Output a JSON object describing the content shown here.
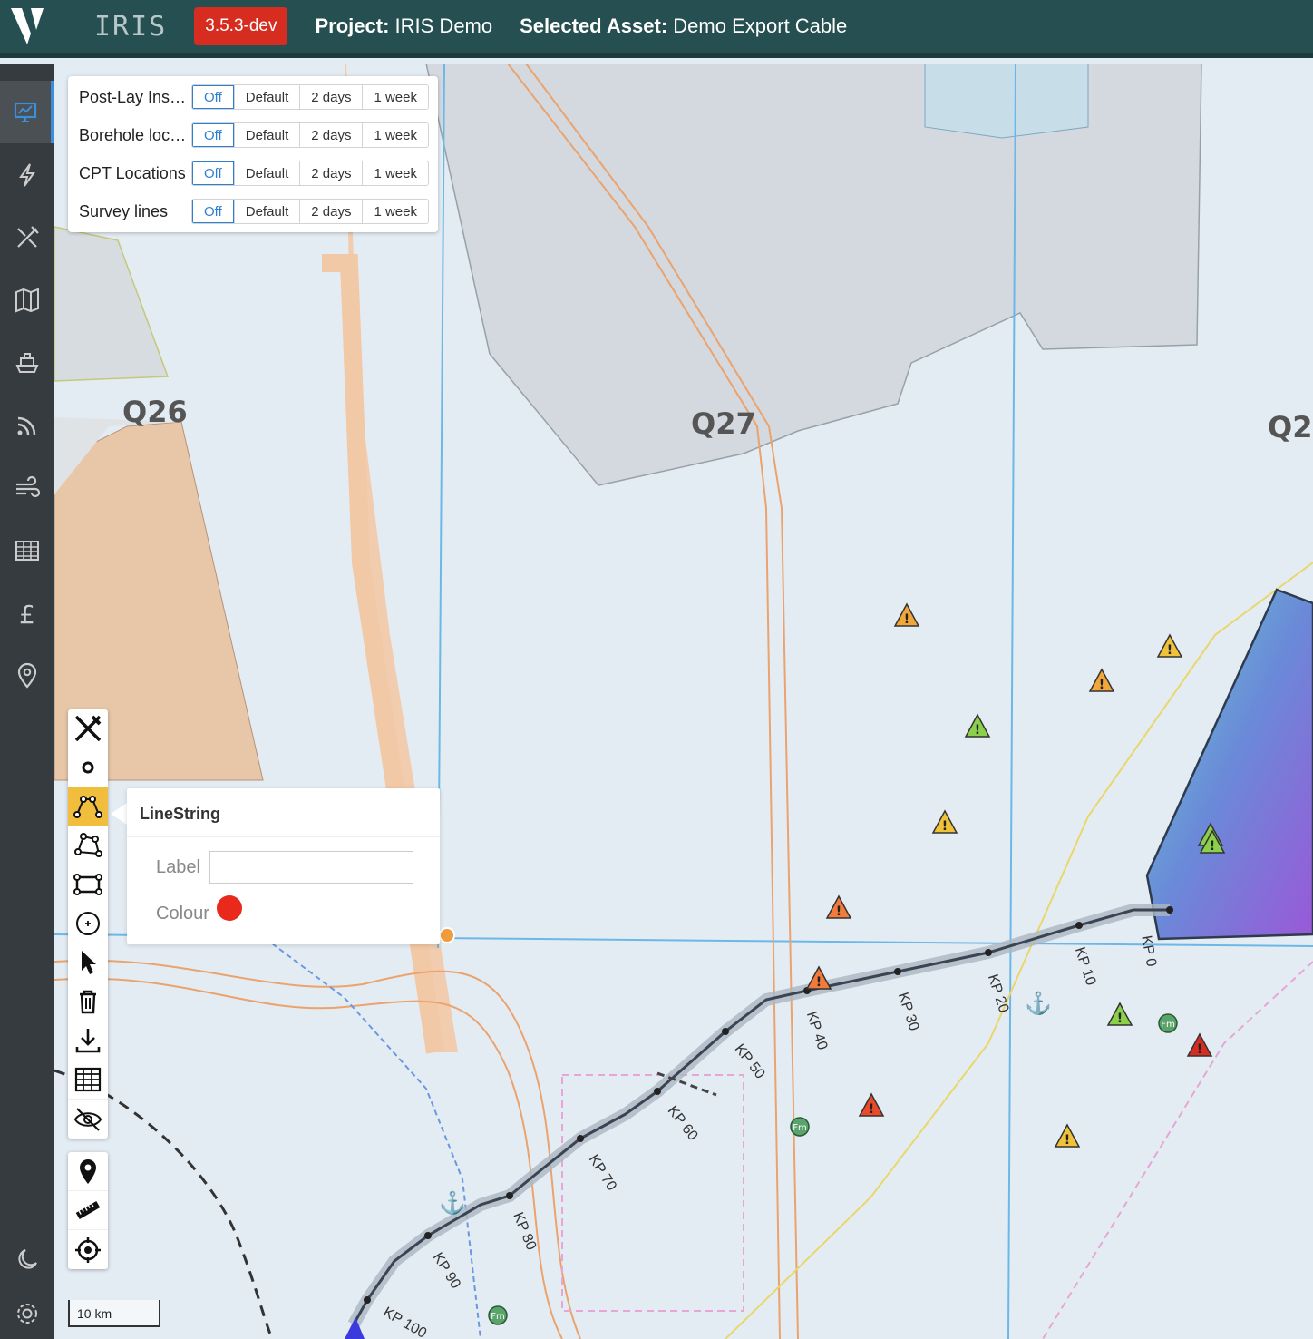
{
  "header": {
    "app_name": "IRIS",
    "version": "3.5.3-dev",
    "project_label": "Project:",
    "project_name": "IRIS Demo",
    "asset_label": "Selected Asset:",
    "asset_name": "Demo Export Cable"
  },
  "sidebar": {
    "items": [
      {
        "icon": "presentation-chart-icon",
        "active": true
      },
      {
        "icon": "lightning-icon",
        "active": false
      },
      {
        "icon": "tools-icon",
        "active": false
      },
      {
        "icon": "map-icon",
        "active": false
      },
      {
        "icon": "ship-icon",
        "active": false
      },
      {
        "icon": "feed-icon",
        "active": false
      },
      {
        "icon": "wind-icon",
        "active": false
      },
      {
        "icon": "table-icon",
        "active": false
      },
      {
        "icon": "pound-icon",
        "active": false
      },
      {
        "icon": "location-pin-icon",
        "active": false
      }
    ],
    "bottom": [
      "moon-icon",
      "gear-icon"
    ]
  },
  "layers": [
    {
      "name": "Post-Lay Inspection",
      "options": [
        "Off",
        "Default",
        "2 days",
        "1 week"
      ],
      "selected": "Off"
    },
    {
      "name": "Borehole locations",
      "options": [
        "Off",
        "Default",
        "2 days",
        "1 week"
      ],
      "selected": "Off"
    },
    {
      "name": "CPT Locations",
      "options": [
        "Off",
        "Default",
        "2 days",
        "1 week"
      ],
      "selected": "Off"
    },
    {
      "name": "Survey lines",
      "options": [
        "Off",
        "Default",
        "2 days",
        "1 week"
      ],
      "selected": "Off"
    }
  ],
  "popup": {
    "title": "LineString",
    "label_label": "Label",
    "label_value": "",
    "colour_label": "Colour",
    "colour": "#e8291c"
  },
  "map": {
    "block_labels": [
      "Q26",
      "Q27",
      "Q2"
    ],
    "kp_labels": [
      "KP 0",
      "KP 10",
      "KP 20",
      "KP 30",
      "KP 40",
      "KP 50",
      "KP 60",
      "KP 70",
      "KP 80",
      "KP 90",
      "KP 100"
    ],
    "scale": "10 km"
  },
  "colors": {
    "header_bg": "#254f50",
    "sidebar_bg": "#363b3f",
    "version_badge": "#d62d20",
    "active_tool": "#f0bd3c"
  }
}
